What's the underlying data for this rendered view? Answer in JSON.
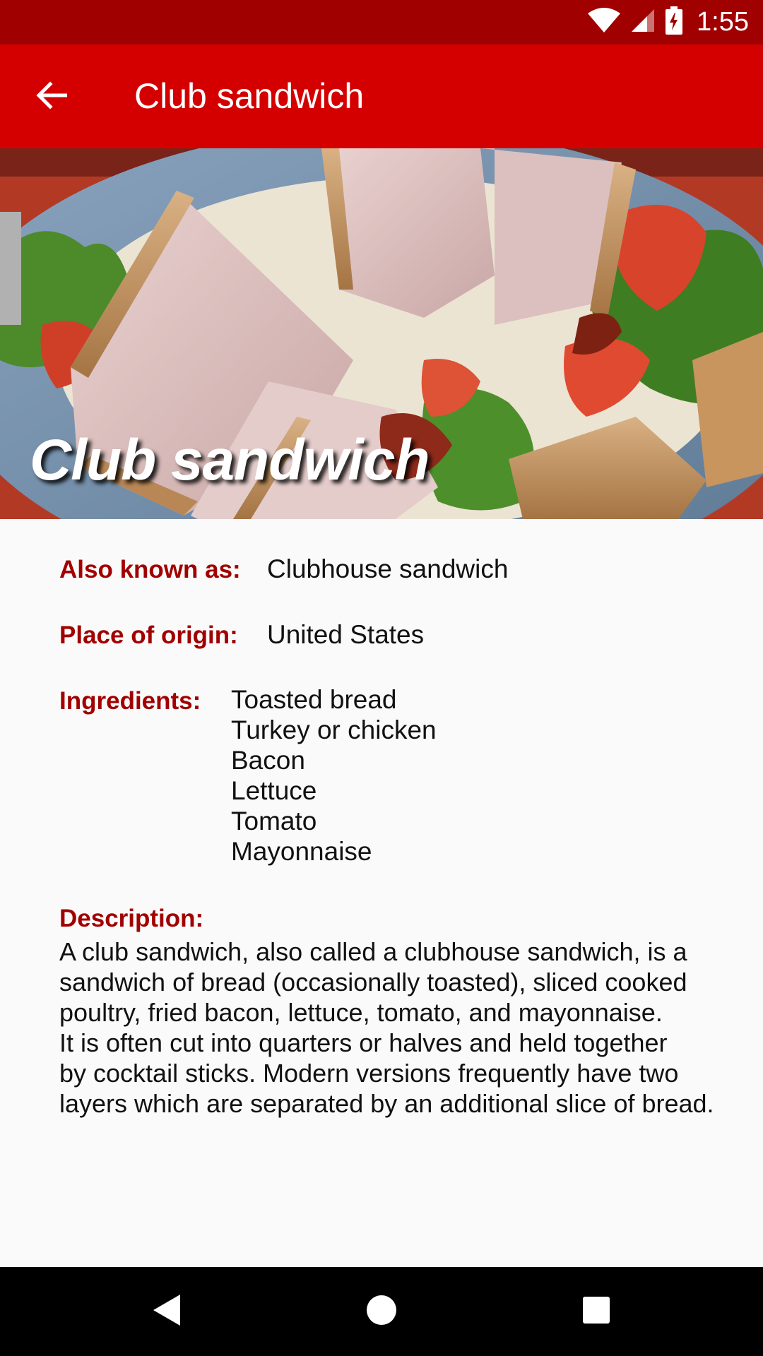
{
  "status_bar": {
    "time": "1:55",
    "icons": [
      "wifi-icon",
      "signal-icon",
      "battery-charging-icon"
    ]
  },
  "app_bar": {
    "title": "Club sandwich",
    "back_icon": "arrow-back-icon"
  },
  "hero": {
    "caption": "Club sandwich"
  },
  "details": {
    "also_known_as_label": "Also known as:",
    "also_known_as_value": "Clubhouse sandwich",
    "place_of_origin_label": "Place of origin:",
    "place_of_origin_value": "United States",
    "ingredients_label": "Ingredients:",
    "ingredients": [
      "Toasted bread",
      "Turkey or chicken",
      "Bacon",
      "Lettuce",
      "Tomato",
      "Mayonnaise"
    ],
    "description_label": "Description:",
    "description": "A club sandwich, also called a clubhouse sandwich, is a\nsandwich of bread (occasionally toasted), sliced cooked\npoultry, fried bacon, lettuce, tomato, and mayonnaise.\nIt is often cut into quarters or halves and held together\nby cocktail sticks. Modern versions frequently have two\nlayers which are separated by an additional slice of bread."
  },
  "nav_bar": {
    "icons": [
      "nav-back-icon",
      "nav-home-icon",
      "nav-recents-icon"
    ]
  },
  "colors": {
    "status_bar": "#a10000",
    "app_bar": "#d40000",
    "label": "#a10000",
    "background": "#fafafa"
  }
}
